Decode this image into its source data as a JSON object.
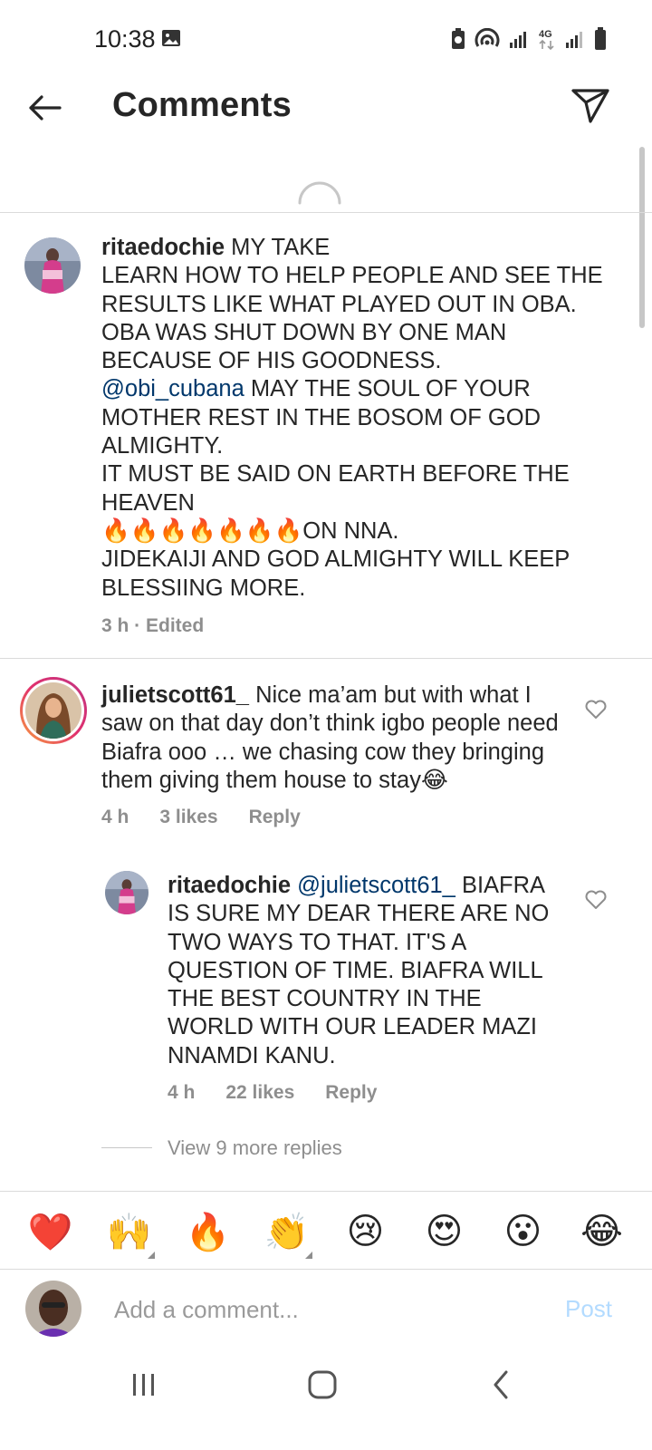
{
  "status_bar": {
    "time": "10:38",
    "network_label": "4G"
  },
  "header": {
    "title": "Comments"
  },
  "comments": [
    {
      "username": "ritaedochie",
      "text_1": " MY TAKE\nLEARN HOW TO HELP PEOPLE AND SEE THE RESULTS LIKE WHAT PLAYED OUT IN OBA. OBA WAS SHUT DOWN BY ONE MAN BECAUSE OF HIS GOODNESS.\n",
      "mention": "@obi_cubana",
      "text_2": " MAY THE SOUL OF YOUR MOTHER REST IN THE BOSOM OF GOD ALMIGHTY.\nIT MUST BE SAID ON EARTH BEFORE THE HEAVEN\n🔥🔥🔥🔥🔥🔥🔥ON NNA.\nJIDEKAIJI AND GOD ALMIGHTY WILL KEEP BLESSIING MORE.",
      "time": "3 h · Edited"
    },
    {
      "username": "julietscott61_",
      "text": " Nice ma’am but with what I saw on that day don’t think igbo people need Biafra ooo … we chasing cow they bringing them giving them house to stay😂",
      "time": "4 h",
      "likes": "3 likes",
      "reply_label": "Reply"
    }
  ],
  "reply": {
    "username": "ritaedochie",
    "mention": "@julietscott61_",
    "text": " BIAFRA IS SURE MY DEAR THERE ARE NO TWO WAYS TO THAT. IT'S A QUESTION OF TIME. BIAFRA WILL THE BEST COUNTRY IN THE WORLD WITH OUR LEADER MAZI NNAMDI KANU.",
    "time": "4 h",
    "likes": "22 likes",
    "reply_label": "Reply"
  },
  "view_more": "View 9 more replies",
  "emoji_bar": [
    "❤️",
    "🙌",
    "🔥",
    "👏",
    "😢",
    "😍",
    "😮",
    "😂"
  ],
  "composer": {
    "placeholder": "Add a comment...",
    "post_label": "Post"
  },
  "colors": {
    "mention": "#00376b",
    "post_disabled": "#b3dbff",
    "meta": "#8e8e8e"
  }
}
